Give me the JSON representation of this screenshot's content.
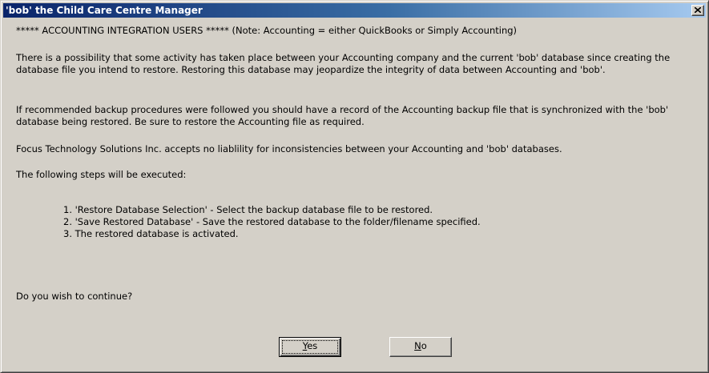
{
  "window": {
    "title": "'bob' the Child Care Centre Manager"
  },
  "message": {
    "header": "***** ACCOUNTING INTEGRATION USERS ***** (Note: Accounting  = either QuickBooks or Simply Accounting)",
    "paragraph1": "There is a possibility that some activity has taken place between your Accounting company and the current 'bob' database since creating the database file you intend to restore. Restoring this database may jeopardize the integrity of data between Accounting and 'bob'.",
    "paragraph2": "If recommended backup procedures were followed you should have a record of the Accounting backup file that is synchronized with the 'bob' database being restored. Be sure to restore the Accounting file as required.",
    "paragraph3": "Focus Technology Solutions Inc. accepts no liablility for inconsistencies between your Accounting and 'bob' databases.",
    "steps_intro": "The following steps will be executed:",
    "steps": [
      "1. 'Restore Database Selection' -  Select the backup database file to be restored.",
      "2. 'Save Restored Database' - Save the restored database to the folder/filename specified.",
      "3. The restored database is activated."
    ],
    "question": "Do you wish to continue?"
  },
  "buttons": {
    "yes_mnemonic": "Y",
    "yes_rest": "es",
    "no_mnemonic": "N",
    "no_rest": "o"
  },
  "icons": {
    "close": "close-icon"
  },
  "colors": {
    "title_bar_start": "#0a246a",
    "title_bar_end": "#a6caf0",
    "dialog_face": "#d4d0c8"
  }
}
